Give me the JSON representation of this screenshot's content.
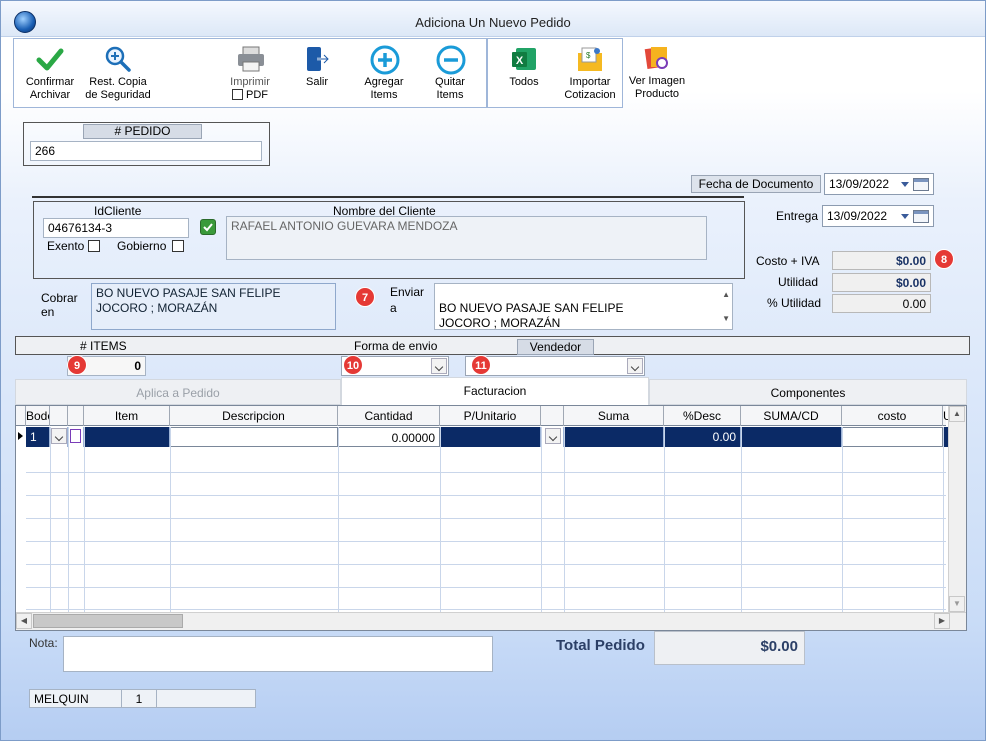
{
  "window": {
    "title": "Adiciona Un Nuevo Pedido"
  },
  "toolbar": {
    "confirmar": "Confirmar\nArchivar",
    "restaurar": "Rest. Copia\nde Seguridad",
    "imprimir": "Imprimir",
    "pdf": "PDF",
    "salir": "Salir",
    "agregar": "Agregar\nItems",
    "quitar": "Quitar\nItems",
    "todos": "Todos",
    "importar": "Importar\nCotizacion",
    "ver_imagen": "Ver Imagen\nProducto"
  },
  "pedido": {
    "label": "# PEDIDO",
    "value": "266"
  },
  "fecha_documento": {
    "label": "Fecha de  Documento",
    "value": "13/09/2022"
  },
  "entrega": {
    "label": "Entrega",
    "value": "13/09/2022"
  },
  "cliente": {
    "id_label": "IdCliente",
    "id_value": "04676134-3",
    "nombre_label": "Nombre del Cliente",
    "nombre_value": "RAFAEL ANTONIO GUEVARA MENDOZA",
    "exento_label": "Exento",
    "gobierno_label": "Gobierno"
  },
  "cobrar": {
    "label": "Cobrar\nen",
    "value": "BO NUEVO PASAJE SAN FELIPE\nJOCORO ; MORAZÁN"
  },
  "enviar": {
    "label": "Enviar\na",
    "value": "BO NUEVO PASAJE SAN FELIPE\nJOCORO ; MORAZÁN"
  },
  "resumen": {
    "costo_iva_label": "Costo + IVA",
    "costo_iva_value": "$0.00",
    "utilidad_label": "Utilidad",
    "utilidad_value": "$0.00",
    "pct_utilidad_label": "% Utilidad",
    "pct_utilidad_value": "0.00"
  },
  "badges": {
    "b7": "7",
    "b8": "8",
    "b9": "9",
    "b10": "10",
    "b11": "11"
  },
  "strip": {
    "items_label": "# ITEMS",
    "items_value": "0",
    "forma_envio_label": "Forma de envio",
    "vendedor_label": "Vendedor"
  },
  "tabs": {
    "aplica": "Aplica a Pedido",
    "facturacion": "Facturacion",
    "componentes": "Componentes"
  },
  "grid": {
    "columns": [
      "Bodega",
      "",
      "Item",
      "Descripcion",
      "Cantidad",
      "P/Unitario",
      "",
      "Suma",
      "%Desc",
      "SUMA/CD",
      "costo",
      "U"
    ],
    "row": {
      "bodega": "1",
      "cantidad": "0.00000",
      "desc": "0.00"
    }
  },
  "nota": {
    "label": "Nota:",
    "value": ""
  },
  "total": {
    "label": "Total Pedido",
    "value": "$0.00"
  },
  "status": {
    "user": "MELQUIN",
    "num": "1",
    "extra": ""
  }
}
